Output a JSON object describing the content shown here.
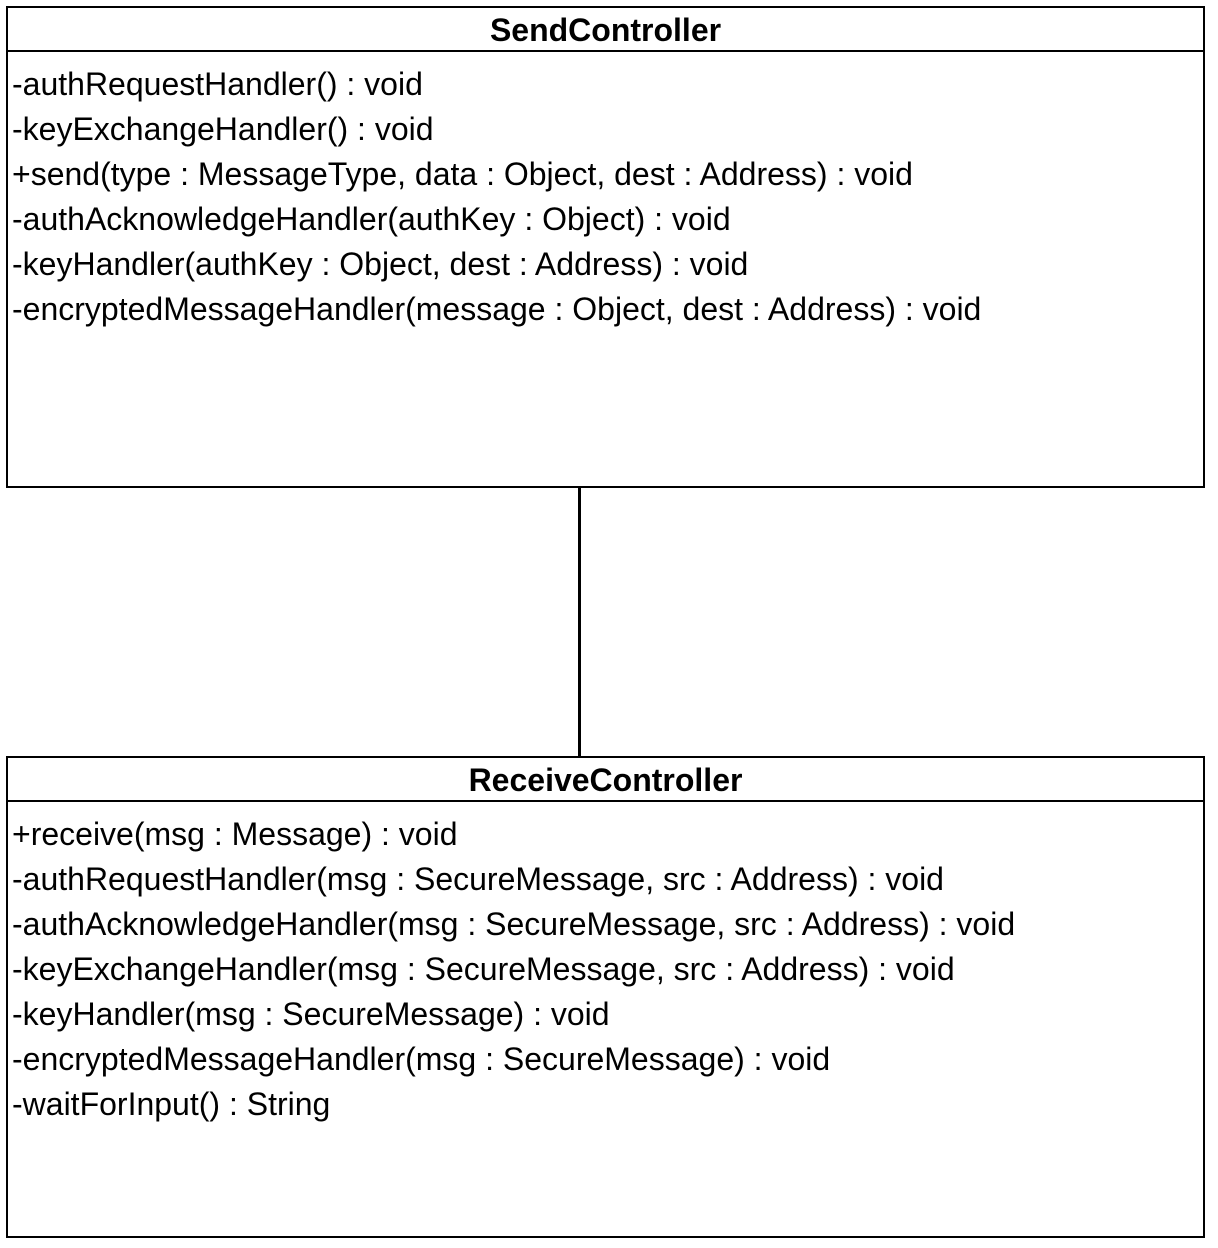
{
  "classes": [
    {
      "name": "SendController",
      "operations": [
        "-authRequestHandler() : void",
        "-keyExchangeHandler() : void",
        "+send(type : MessageType, data : Object, dest : Address) : void",
        "-authAcknowledgeHandler(authKey : Object) : void",
        "-keyHandler(authKey : Object, dest : Address) : void",
        "-encryptedMessageHandler(message : Object, dest : Address) : void"
      ]
    },
    {
      "name": "ReceiveController",
      "operations": [
        "+receive(msg : Message) : void",
        "-authRequestHandler(msg : SecureMessage, src : Address) : void",
        "-authAcknowledgeHandler(msg : SecureMessage, src : Address) : void",
        "-keyExchangeHandler(msg : SecureMessage, src : Address) : void",
        "-keyHandler(msg : SecureMessage) : void",
        "-encryptedMessageHandler(msg : SecureMessage) : void",
        "-waitForInput() : String"
      ]
    }
  ],
  "association": {
    "from": "SendController",
    "to": "ReceiveController"
  }
}
